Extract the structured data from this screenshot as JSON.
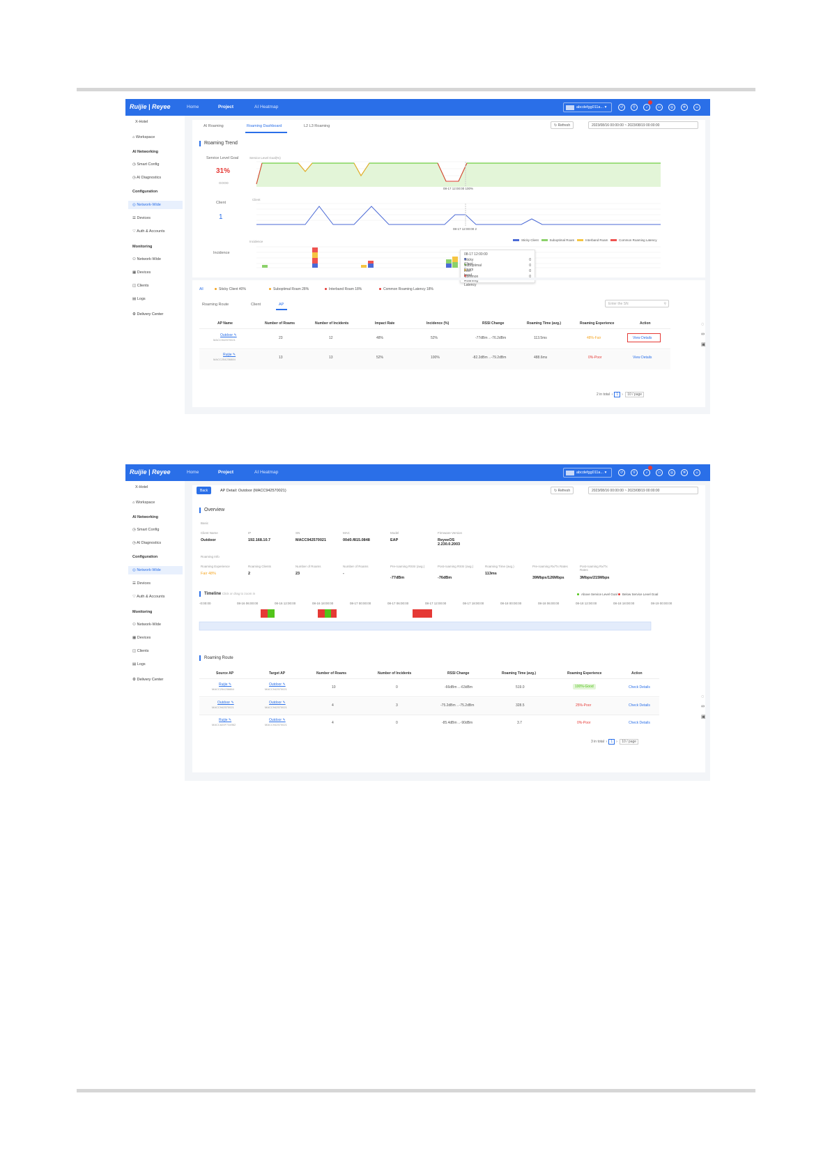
{
  "top": {
    "logo": "Ruijie | Reyee",
    "nav": [
      "Home",
      "Project",
      "AI Heatmap"
    ],
    "user": "abcdefgg011a...",
    "notif_count": "1"
  },
  "sidebar": {
    "project": "X-Hotel",
    "workspace": "Workspace",
    "ai_networking": "AI Networking",
    "smart_config": "Smart Config",
    "ai_diagnostics": "AI Diagnostics",
    "configuration": "Configuration",
    "network_wide": "Network-Wide",
    "devices": "Devices",
    "auth": "Auth & Accounts",
    "monitoring": "Monitoring",
    "mon_network": "Network-Wide",
    "mon_devices": "Devices",
    "mon_clients": "Clients",
    "mon_logs": "Logs",
    "delivery": "Delivery Center"
  },
  "screen1": {
    "tabs": [
      "AI Roaming",
      "Roaming Dashboard",
      "L2 L3 Roaming"
    ],
    "refresh": "Refresh",
    "date_range": "2023/08/16 00:00:00  ~  2023/08/19 00:00:00",
    "section_title": "Roaming Trend",
    "slg_label": "Service Level Goal",
    "slg_value": "31%",
    "slg_sub": "GOOD",
    "slg_axis": "Service Level Goal(%)",
    "client_label": "Client",
    "client_value": "1",
    "client_axis": "Client",
    "incidence_label": "Incidence",
    "incidence_axis": "Incidence",
    "slg_tooltip": "08-17 12:00:00 100%",
    "client_tooltip": "08-17 12:00:00 2",
    "legend": [
      "Sticky Client",
      "Suboptimal Roam",
      "Interband Roam",
      "Common Roaming Latency"
    ],
    "tooltip": {
      "time": "08-17 12:00:00",
      "rows": [
        {
          "label": "Sticky Client",
          "value": "0"
        },
        {
          "label": "Suboptimal Roam",
          "value": "0"
        },
        {
          "label": "Inter-band Roam",
          "value": "0"
        },
        {
          "label": "Common Roaming Latency",
          "value": "0"
        }
      ]
    },
    "filters": [
      "All",
      "Sticky Client  40%",
      "Suboptimal Roam  28%",
      "Interband Roam  18%",
      "Common Roaming Latency  18%"
    ],
    "subtabs": [
      "Roaming Route",
      "Client",
      "AP"
    ],
    "search_placeholder": "Enter the SN",
    "columns": [
      "AP Name",
      "Number of Roams",
      "Number of Incidents",
      "Impact Rate",
      "Incidence (%)",
      "RSSI Change",
      "Roaming Time (avg.)",
      "Roaming Experience",
      "Action"
    ],
    "rows": [
      {
        "name": "Outdoor",
        "sn": "MACC942570021",
        "roams": "23",
        "incidents": "12",
        "impact": "48%",
        "incidence": "52%",
        "rssi": "-77dBm→-76.2dBm",
        "time": "113.5ms",
        "exp": "48%-Fair",
        "action": "View Details"
      },
      {
        "name": "Ruijie",
        "sn": "MACC254236884",
        "roams": "13",
        "incidents": "13",
        "impact": "52%",
        "incidence": "100%",
        "rssi": "-82.2dBm→-79.2dBm",
        "time": "488.6ms",
        "exp": "0%-Poor",
        "action": "View Details"
      }
    ],
    "pager_total": "2 in total",
    "pager_page": "1",
    "pager_size": "10 / page"
  },
  "screen2": {
    "back": "Back",
    "detail_label": "AP Detail:",
    "detail_value": "Outdoor (MACC942570021)",
    "refresh": "Refresh",
    "date_range": "2023/08/16 00:00:00  ~  2023/08/19 00:00:00",
    "overview": "Overview",
    "basic": "Basic",
    "basic_fields": [
      {
        "k": "Client Name",
        "v": "Outdoor"
      },
      {
        "k": "IP",
        "v": "192.168.10.7"
      },
      {
        "k": "SN",
        "v": "MACC942570021"
      },
      {
        "k": "MAC",
        "v": "00d0.f815.0848"
      },
      {
        "k": "Model",
        "v": "EAP"
      },
      {
        "k": "Firmware Version",
        "v": "ReyeeOS 2.230.0.2003"
      }
    ],
    "roaming_info": "Roaming Info",
    "roam_fields": [
      {
        "k": "Roaming Experience",
        "v": "Fair 48%"
      },
      {
        "k": "Roaming Clients",
        "v": "2"
      },
      {
        "k": "Number of Roams",
        "v": "23"
      },
      {
        "k": "Number of Roams",
        "v": "-"
      },
      {
        "k": "Pre-roaming RSSI (avg.)",
        "v": "-77dBm"
      },
      {
        "k": "Post-roaming RSSI (avg.)",
        "v": "-76dBm"
      },
      {
        "k": "Roaming Time (avg.)",
        "v": "113ms"
      },
      {
        "k": "Pre-roaming Rx/Tx Rates",
        "v": "39Mbps/126Mbps"
      },
      {
        "k": "Post-roaming Rx/Tx Rates",
        "v": "3Mbps/215Mbps"
      }
    ],
    "timeline": "Timeline",
    "timeline_hint": "Click or drag to zoom in",
    "timeline_legend": [
      "Above Service Level Goal",
      "Below Service Level Goal"
    ],
    "timeline_ticks": [
      "-0:00:00",
      "08-16 06:00:00",
      "08-16 12:00:00",
      "08-16 18:00:00",
      "08-17 00:00:00",
      "08-17 06:00:00",
      "08-17 12:00:00",
      "08-17 18:00:00",
      "08-18 00:00:00",
      "08-18 06:00:00",
      "08-18 12:00:00",
      "08-18 18:00:00",
      "08-19 00:00:00"
    ],
    "route_title": "Roaming Route",
    "columns": [
      "Source AP",
      "Target AP",
      "Number of Roams",
      "Number of Incidents",
      "RSSI Change",
      "Roaming Time (avg.)",
      "Roaming Experience",
      "Action"
    ],
    "rows": [
      {
        "src": "Ruijie",
        "src_sn": "MACC254236884",
        "dst": "Outdoor",
        "dst_sn": "MACC942570021",
        "roams": "10",
        "incidents": "0",
        "rssi": "-66dBm→-63dBm",
        "time": "519.0",
        "exp": "100%-Good",
        "action": "Check Details"
      },
      {
        "src": "Outdoor",
        "src_sn": "MACC942570021",
        "dst": "Outdoor",
        "dst_sn": "MACC942570021",
        "roams": "4",
        "incidents": "3",
        "rssi": "-75.2dBm→-75.2dBm",
        "time": "328.5",
        "exp": "25%-Poor",
        "action": "Check Details"
      },
      {
        "src": "Ruijie",
        "src_sn": "MACC820F734962",
        "dst": "Outdoor",
        "dst_sn": "MACC942570021",
        "roams": "4",
        "incidents": "0",
        "rssi": "-85.4dBm→-90dBm",
        "time": "3.7",
        "exp": "0%-Poor",
        "action": "Check Details"
      }
    ],
    "pager_total": "3 in total",
    "pager_page": "1",
    "pager_size": "10 / page"
  },
  "colors": {
    "brand": "#2a6fe8",
    "good": "#52c41a",
    "poor": "#e53935",
    "fair": "#f5a623",
    "sticky": "#4b6ad6",
    "subopt": "#8bd16a",
    "interband": "#f5c542",
    "latency": "#ef5350"
  }
}
